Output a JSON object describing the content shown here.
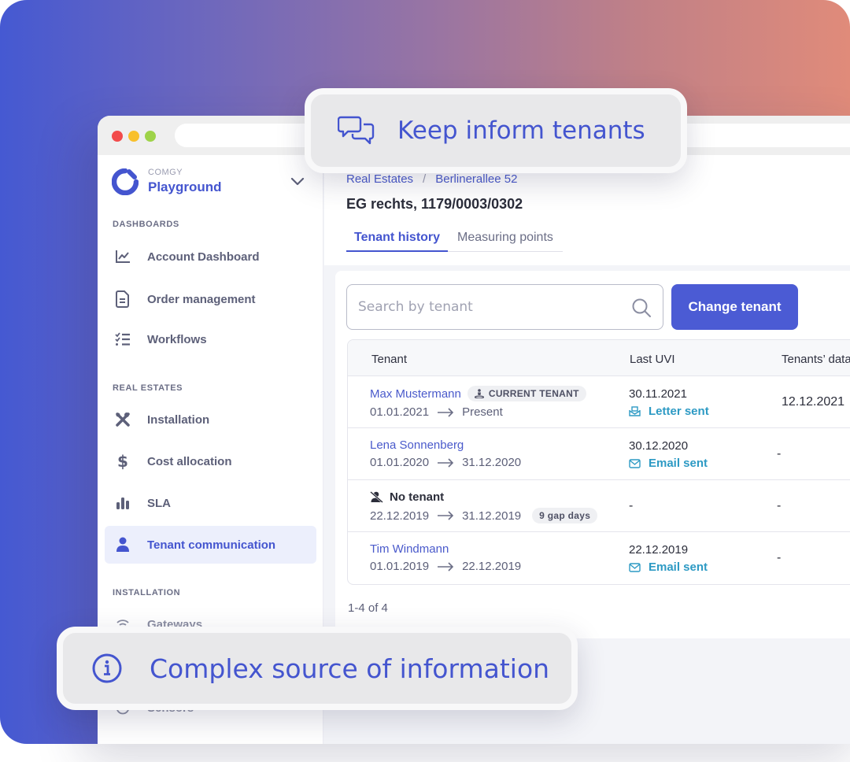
{
  "callouts": {
    "top": {
      "icon": "chat-bubbles-icon",
      "text": "Keep inform tenants"
    },
    "bottom": {
      "icon": "info-icon",
      "text": "Complex source of information"
    }
  },
  "colors": {
    "accent": "#4455cf",
    "primary_button": "#4b5bd4",
    "status_link": "#2d9ac4",
    "gradient_start": "#4559d2",
    "gradient_end": "#e08b7a"
  },
  "window": {
    "traffic_lights": [
      "close",
      "minimize",
      "maximize"
    ]
  },
  "sidebar": {
    "brand": {
      "company": "COMGY",
      "name": "Playground"
    },
    "sections": [
      {
        "label": "DASHBOARDS",
        "items": [
          {
            "label": "Account Dashboard",
            "icon": "chart-line-icon"
          },
          {
            "label": "Order management",
            "icon": "document-icon"
          },
          {
            "label": "Workflows",
            "icon": "checklist-icon"
          }
        ]
      },
      {
        "label": "REAL ESTATES",
        "items": [
          {
            "label": "Installation",
            "icon": "tools-icon"
          },
          {
            "label": "Cost allocation",
            "icon": "dollar-icon"
          },
          {
            "label": "SLA",
            "icon": "bar-chart-icon"
          },
          {
            "label": "Tenant communication",
            "icon": "user-icon",
            "active": true
          }
        ]
      },
      {
        "label": "INSTALLATION",
        "items": [
          {
            "label": "Gateways",
            "icon": "wifi-icon"
          },
          {
            "label": "Sensors",
            "icon": "sensor-icon"
          }
        ]
      }
    ]
  },
  "main": {
    "breadcrumb": [
      "Real Estates",
      "Berlinerallee 52"
    ],
    "breadcrumb_separator": "/",
    "title": "EG rechts, 1179/0003/0302",
    "tabs": [
      {
        "label": "Tenant history",
        "active": true
      },
      {
        "label": "Measuring points",
        "active": false
      }
    ],
    "search": {
      "placeholder": "Search by tenant",
      "value": ""
    },
    "change_tenant_label": "Change tenant",
    "table": {
      "columns": [
        "Tenant",
        "Last UVI",
        "Tenants’ data"
      ],
      "rows": [
        {
          "tenant": "Max Mustermann",
          "badge": "CURRENT TENANT",
          "from": "01.01.2021",
          "to": "Present",
          "uvi_date": "30.11.2021",
          "uvi_status": "Letter sent",
          "uvi_status_icon": "letter-icon",
          "tenants_data": "12.12.2021"
        },
        {
          "tenant": "Lena Sonnenberg",
          "from": "01.01.2020",
          "to": "31.12.2020",
          "uvi_date": "30.12.2020",
          "uvi_status": "Email sent",
          "uvi_status_icon": "email-icon",
          "tenants_data": "-"
        },
        {
          "tenant": "No tenant",
          "no_tenant": true,
          "from": "22.12.2019",
          "to": "31.12.2019",
          "gap_badge": "9 gap days",
          "uvi_date": "-",
          "tenants_data": "-"
        },
        {
          "tenant": "Tim Windmann",
          "from": "01.01.2019",
          "to": "22.12.2019",
          "uvi_date": "22.12.2019",
          "uvi_status": "Email sent",
          "uvi_status_icon": "email-icon",
          "tenants_data": "-"
        }
      ]
    },
    "pagination": "1-4 of 4"
  }
}
